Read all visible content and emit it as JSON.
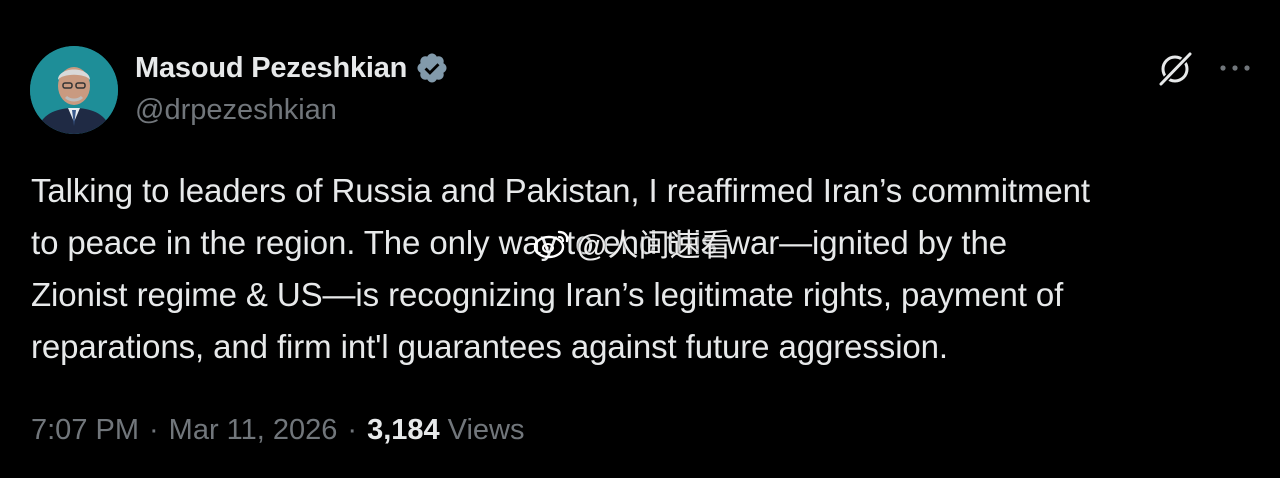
{
  "author": {
    "display_name": "Masoud Pezeshkian",
    "handle": "@drpezeshkian",
    "verified": true,
    "avatar_icon": "person-avatar"
  },
  "tweet": {
    "lines": [
      "Talking to leaders of Russia and Pakistan, I reaffirmed Iran’s commitment",
      "to peace in the region. The only way to end this war—ignited by the",
      "Zionist regime & US—is recognizing Iran’s legitimate rights, payment of",
      "reparations, and firm int'l guarantees against future aggression."
    ]
  },
  "meta": {
    "time": "7:07 PM",
    "separator": "·",
    "date": "Mar 11, 2026",
    "views_count": "3,184",
    "views_label": "Views"
  },
  "watermark": {
    "text": "@人间速看",
    "icon": "weibo-icon"
  },
  "icons": {
    "verified": "verified-badge-icon",
    "grok": "grok-icon",
    "more": "more-options-icon"
  },
  "colors": {
    "background": "#000000",
    "text_primary": "#e7e9ea",
    "text_secondary": "#71767b",
    "verified_badge": "#829aab"
  }
}
